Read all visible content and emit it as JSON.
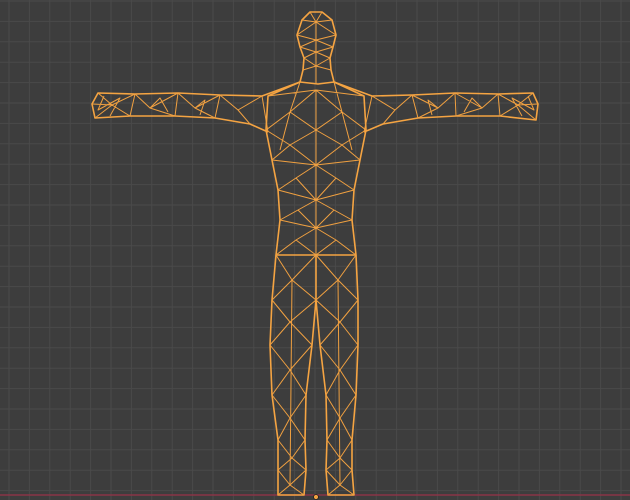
{
  "viewport": {
    "background_color": "#3d3d3d",
    "grid_color": "#4a4a4a",
    "x_axis_color": "#8a3447",
    "selection_color": "#f0a040",
    "object": {
      "name": "",
      "selected": true,
      "display": "wireframe"
    },
    "origin_icon": "object-origin-icon"
  }
}
